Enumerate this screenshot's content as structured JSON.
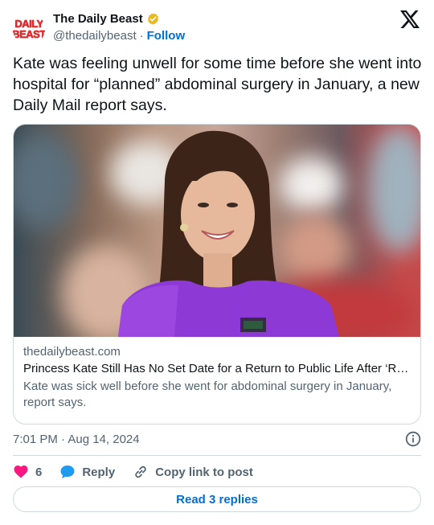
{
  "author": {
    "name": "The Daily Beast",
    "handle": "@thedailybeast",
    "separator": "·",
    "follow_label": "Follow",
    "logo_text": [
      "DAILY",
      "BEAST"
    ],
    "verified_color": "#e8b829"
  },
  "tweet": {
    "text": "Kate was feeling unwell for some time before she went into hospital for “planned” abdominal surgery in January, a new Daily Mail report says."
  },
  "link_card": {
    "image_icon": "photo-woman-purple-dress",
    "domain": "thedailybeast.com",
    "title": "Princess Kate Still Has No Set Date for a Return to Public Life After ‘Ro…",
    "description": "Kate was sick well before she went for abdominal surgery in January, report says."
  },
  "meta": {
    "timestamp": "7:01 PM · Aug 14, 2024"
  },
  "actions": {
    "like_count": "6",
    "reply_label": "Reply",
    "copy_label": "Copy link to post",
    "like_color": "#f91880",
    "reply_color": "#1d9bf0"
  },
  "read_replies_label": "Read 3 replies",
  "colors": {
    "accent": "#006fd6",
    "muted": "#536471",
    "border": "#cfd9de"
  }
}
